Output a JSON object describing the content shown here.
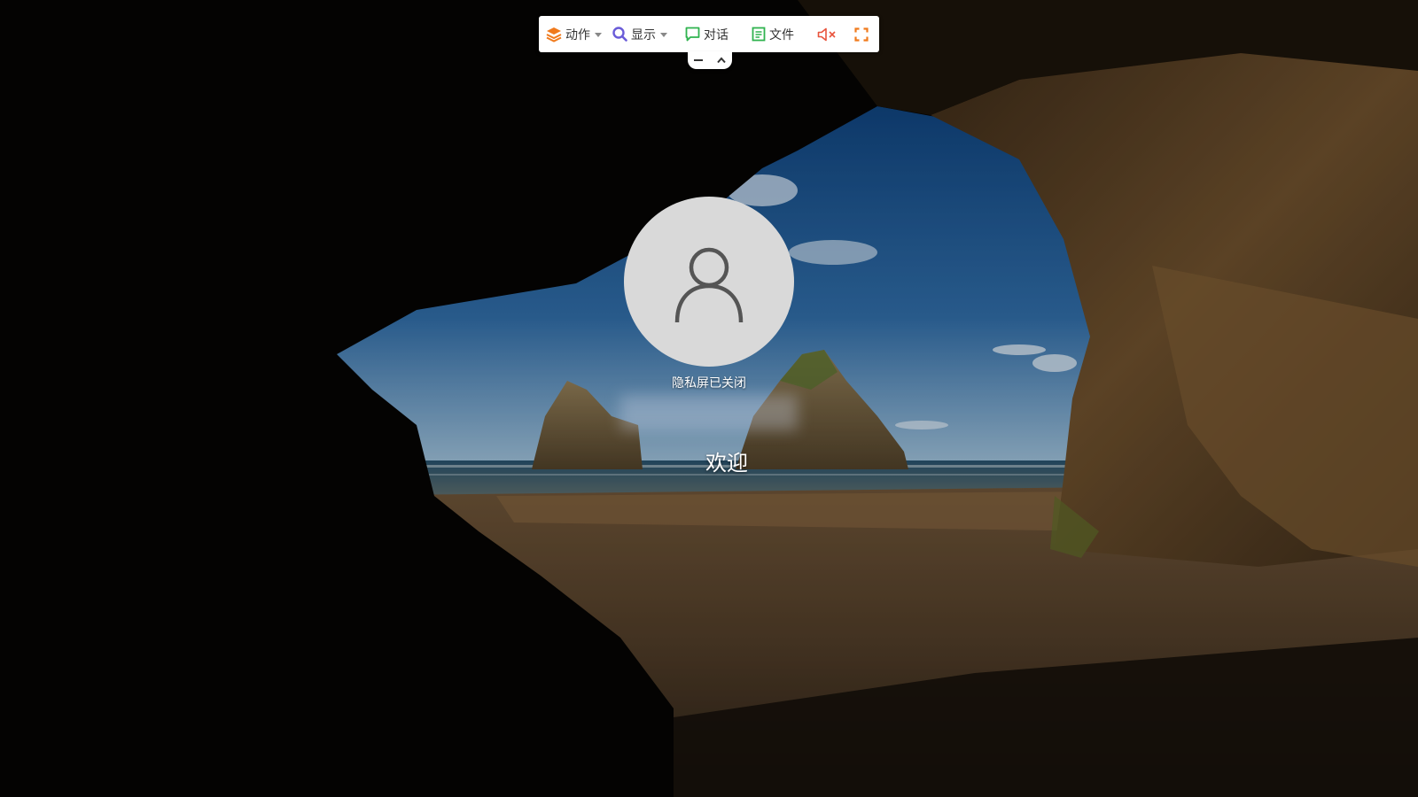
{
  "toolbar": {
    "actions_label": "动作",
    "display_label": "显示",
    "chat_label": "对话",
    "files_label": "文件"
  },
  "icons": {
    "actions": "layers-icon",
    "display": "magnifier-icon",
    "chat": "chat-bubble-icon",
    "files": "document-icon",
    "mute": "speaker-muted-icon",
    "fullscreen": "fullscreen-icon",
    "minimize": "minus-icon",
    "collapse": "chevron-up-icon"
  },
  "colors": {
    "actions": "#f07a1c",
    "display": "#6a5cd8",
    "chat": "#2fb34f",
    "files": "#2fb34f",
    "mute": "#e8533c",
    "fullscreen": "#f07a1c"
  },
  "login": {
    "privacy_status": "隐私屏已关闭",
    "welcome": "欢迎"
  }
}
